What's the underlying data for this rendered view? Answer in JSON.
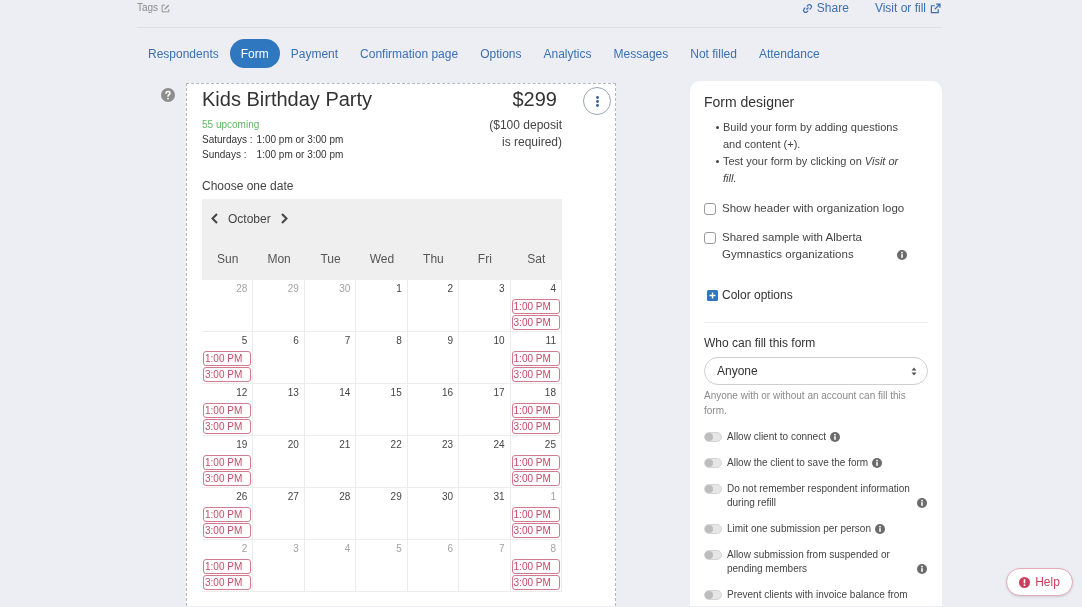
{
  "header": {
    "tags_label": "Tags",
    "links": [
      {
        "kind": "share",
        "label": "Share"
      },
      {
        "kind": "visit",
        "label": "Visit or fill"
      }
    ]
  },
  "tabs": [
    {
      "label": "Respondents",
      "selected": false
    },
    {
      "label": "Form",
      "selected": true
    },
    {
      "label": "Payment",
      "selected": false
    },
    {
      "label": "Confirmation page",
      "selected": false
    },
    {
      "label": "Options",
      "selected": false
    },
    {
      "label": "Analytics",
      "selected": false
    },
    {
      "label": "Messages",
      "selected": false
    },
    {
      "label": "Not filled",
      "selected": false
    },
    {
      "label": "Attendance",
      "selected": false
    }
  ],
  "form": {
    "title": "Kids Birthday Party",
    "price": "$299",
    "upcoming": "55 upcoming",
    "schedule": [
      {
        "day": "Saturdays :",
        "times": "1:00 pm or 3:00 pm"
      },
      {
        "day": "Sundays :",
        "times": "1:00 pm or 3:00 pm"
      }
    ],
    "deposit_note": "($100 deposit is required)",
    "question_label": "Choose one date",
    "calendar": {
      "month": "October",
      "weekdays": [
        "Sun",
        "Mon",
        "Tue",
        "Wed",
        "Thu",
        "Fri",
        "Sat"
      ],
      "weeks": [
        [
          {
            "day": "28",
            "muted": true
          },
          {
            "day": "29",
            "muted": true
          },
          {
            "day": "30",
            "muted": true
          },
          {
            "day": "1",
            "muted": false
          },
          {
            "day": "2",
            "muted": false
          },
          {
            "day": "3",
            "muted": false
          },
          {
            "day": "4",
            "muted": false,
            "slots": [
              "1:00 PM",
              "3:00 PM"
            ]
          }
        ],
        [
          {
            "day": "5",
            "muted": false,
            "slots": [
              "1:00 PM",
              "3:00 PM"
            ]
          },
          {
            "day": "6",
            "muted": false
          },
          {
            "day": "7",
            "muted": false
          },
          {
            "day": "8",
            "muted": false
          },
          {
            "day": "9",
            "muted": false
          },
          {
            "day": "10",
            "muted": false
          },
          {
            "day": "11",
            "muted": false,
            "slots": [
              "1:00 PM",
              "3:00 PM"
            ]
          }
        ],
        [
          {
            "day": "12",
            "muted": false,
            "slots": [
              "1:00 PM",
              "3:00 PM"
            ]
          },
          {
            "day": "13",
            "muted": false
          },
          {
            "day": "14",
            "muted": false
          },
          {
            "day": "15",
            "muted": false
          },
          {
            "day": "16",
            "muted": false
          },
          {
            "day": "17",
            "muted": false
          },
          {
            "day": "18",
            "muted": false,
            "slots": [
              "1:00 PM",
              "3:00 PM"
            ]
          }
        ],
        [
          {
            "day": "19",
            "muted": false,
            "slots": [
              "1:00 PM",
              "3:00 PM"
            ]
          },
          {
            "day": "20",
            "muted": false
          },
          {
            "day": "21",
            "muted": false
          },
          {
            "day": "22",
            "muted": false
          },
          {
            "day": "23",
            "muted": false
          },
          {
            "day": "24",
            "muted": false
          },
          {
            "day": "25",
            "muted": false,
            "slots": [
              "1:00 PM",
              "3:00 PM"
            ]
          }
        ],
        [
          {
            "day": "26",
            "muted": false,
            "slots": [
              "1:00 PM",
              "3:00 PM"
            ]
          },
          {
            "day": "27",
            "muted": false
          },
          {
            "day": "28",
            "muted": false
          },
          {
            "day": "29",
            "muted": false
          },
          {
            "day": "30",
            "muted": false
          },
          {
            "day": "31",
            "muted": false
          },
          {
            "day": "1",
            "muted": true,
            "slots": [
              "1:00 PM",
              "3:00 PM"
            ]
          }
        ],
        [
          {
            "day": "2",
            "muted": true,
            "slots": [
              "1:00 PM",
              "3:00 PM"
            ]
          },
          {
            "day": "3",
            "muted": true
          },
          {
            "day": "4",
            "muted": true
          },
          {
            "day": "5",
            "muted": true
          },
          {
            "day": "6",
            "muted": true
          },
          {
            "day": "7",
            "muted": true
          },
          {
            "day": "8",
            "muted": true,
            "slots": [
              "1:00 PM",
              "3:00 PM"
            ]
          }
        ]
      ]
    }
  },
  "designer": {
    "title": "Form designer",
    "tips": [
      "Build your form by adding questions and content (+).",
      "Test your form by clicking on *Visit or fill.*"
    ],
    "checkboxes": [
      {
        "label": "Show header with organization logo",
        "checked": false,
        "info": false
      },
      {
        "label": "Shared sample with Alberta Gymnastics organizations",
        "checked": false,
        "info": true
      }
    ],
    "color_options": {
      "label": "Color options",
      "expanded": false
    },
    "who_can_fill": {
      "label": "Who can fill this form",
      "value": "Anyone",
      "hint": "Anyone with or without an account can fill this form."
    },
    "toggles": [
      {
        "label": "Allow client to connect",
        "on": false,
        "info": true
      },
      {
        "label": "Allow the client to save the form",
        "on": false,
        "info": true
      },
      {
        "label": "Do not remember respondent information during refill",
        "on": false,
        "info": true
      },
      {
        "label": "Limit one submission per person",
        "on": false,
        "info": true
      },
      {
        "label": "Allow submission from suspended or pending members",
        "on": false,
        "info": true
      },
      {
        "label": "Prevent clients with invoice balance from",
        "on": false,
        "info": false
      }
    ]
  },
  "help_button": {
    "label": "Help"
  }
}
